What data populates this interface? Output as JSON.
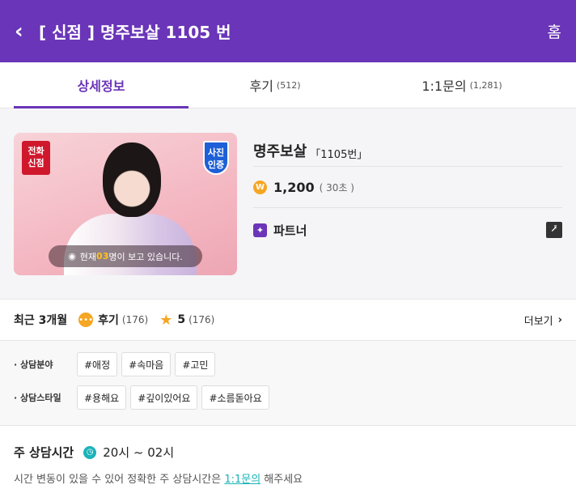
{
  "header": {
    "back_icon": "chevron-left-icon",
    "title": "[ 신점 ] 명주보살 1105 번",
    "home_label": "홈"
  },
  "tabs": [
    {
      "label": "상세정보",
      "count": ""
    },
    {
      "label": "후기",
      "count": "(512)"
    },
    {
      "label": "1:1문의",
      "count": "(1,281)"
    }
  ],
  "profile": {
    "badge_call": "전화\n신점",
    "badge_photo": "사진\n인증",
    "viewers_prefix": "현재 ",
    "viewers_count": "03",
    "viewers_suffix": "명이 보고 있습니다.",
    "name": "명주보살",
    "number": "「1105번」",
    "price": "1,200",
    "price_unit": "( 30초 )",
    "partner": "파트너"
  },
  "reviews": {
    "period": "최근 3개월",
    "label": "후기",
    "count": "(176)",
    "score": "5",
    "score_count": "(176)",
    "more": "더보기"
  },
  "tags": {
    "field_label": "· 상담분야",
    "field_tags": [
      "#애정",
      "#속마음",
      "#고민"
    ],
    "style_label": "· 상담스타일",
    "style_tags": [
      "#용해요",
      "#깊이있어요",
      "#소름돋아요"
    ]
  },
  "hours": {
    "title": "주 상담시간",
    "value": "20시 ~ 02시",
    "note_prefix": "시간 변동이 있을 수 있어 정확한 주 상담시간은 ",
    "note_link": "1:1문의",
    "note_suffix": " 해주세요"
  },
  "colors": {
    "brand": "#6a35b8",
    "accent": "#f5a623",
    "teal": "#1bb3b9"
  }
}
